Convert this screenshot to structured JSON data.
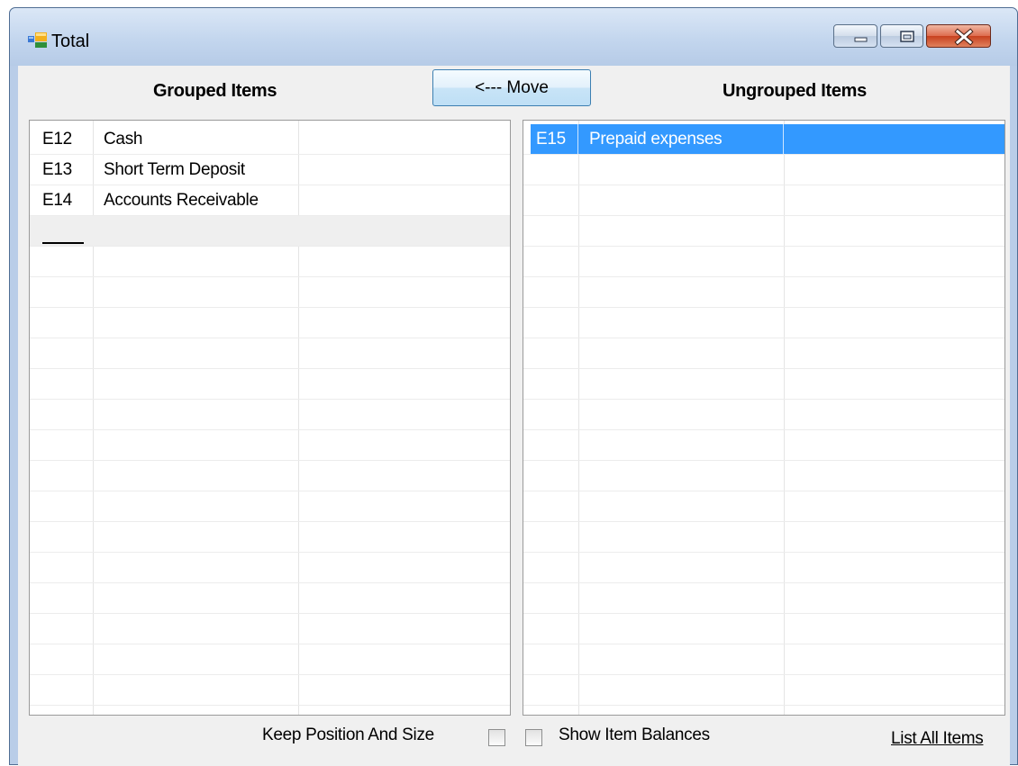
{
  "window": {
    "title": "Total",
    "controls": {
      "minimize": "minimize",
      "maximize": "maximize",
      "close": "close"
    }
  },
  "headers": {
    "grouped": "Grouped Items",
    "ungrouped": "Ungrouped Items"
  },
  "move_button": {
    "label": "<--- Move"
  },
  "grouped_items": [
    {
      "code": "E12",
      "name": "Cash",
      "extra": ""
    },
    {
      "code": "E13",
      "name": "Short Term Deposit",
      "extra": ""
    },
    {
      "code": "E14",
      "name": "Accounts Receivable",
      "extra": ""
    }
  ],
  "ungrouped_items": [
    {
      "code": "E15",
      "name": "Prepaid expenses",
      "extra": "",
      "selected": true
    }
  ],
  "footer": {
    "keep_position_label": "Keep Position And Size",
    "show_balances_label": "Show Item Balances",
    "list_all_link": "List All Items"
  },
  "colors": {
    "selection": "#3399ff",
    "client_bg": "#f0f0f0",
    "titlebar": "#c3d6ee"
  },
  "icons": {
    "app": "app-window-icon",
    "minimize": "minimize-icon",
    "maximize": "maximize-icon",
    "close": "close-icon"
  }
}
